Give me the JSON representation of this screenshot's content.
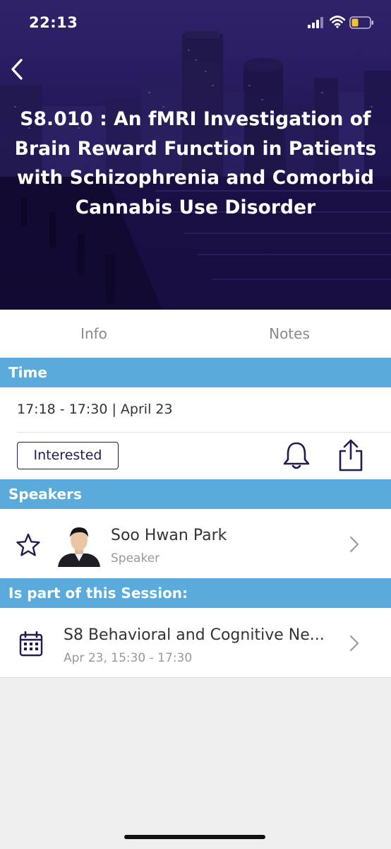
{
  "status_bar": {
    "time": "22:13"
  },
  "header": {
    "title": "S8.010 : An fMRI Investigation of Brain Reward Function in Patients with Schizophrenia and Comorbid Cannabis Use Disorder"
  },
  "tabs": [
    {
      "label": "Info"
    },
    {
      "label": "Notes"
    }
  ],
  "time_section": {
    "header": "Time",
    "value": "17:18 - 17:30 | April 23",
    "interested_label": "Interested"
  },
  "speakers_section": {
    "header": "Speakers",
    "speakers": [
      {
        "name": "Soo Hwan Park",
        "role": "Speaker"
      }
    ]
  },
  "session_section": {
    "header": "Is part of this Session:",
    "session": {
      "title": "S8 Behavioral and Cognitive Ne...",
      "time": "Apr 23, 15:30 - 17:30"
    }
  },
  "colors": {
    "section_header_bg": "#5aabdc",
    "accent_dark": "#241a52",
    "hero_purple": "#2b1c66"
  },
  "icons": {
    "back": "chevron-left-icon",
    "bell": "bell-icon",
    "share": "share-icon",
    "star": "star-icon",
    "calendar": "calendar-icon"
  }
}
